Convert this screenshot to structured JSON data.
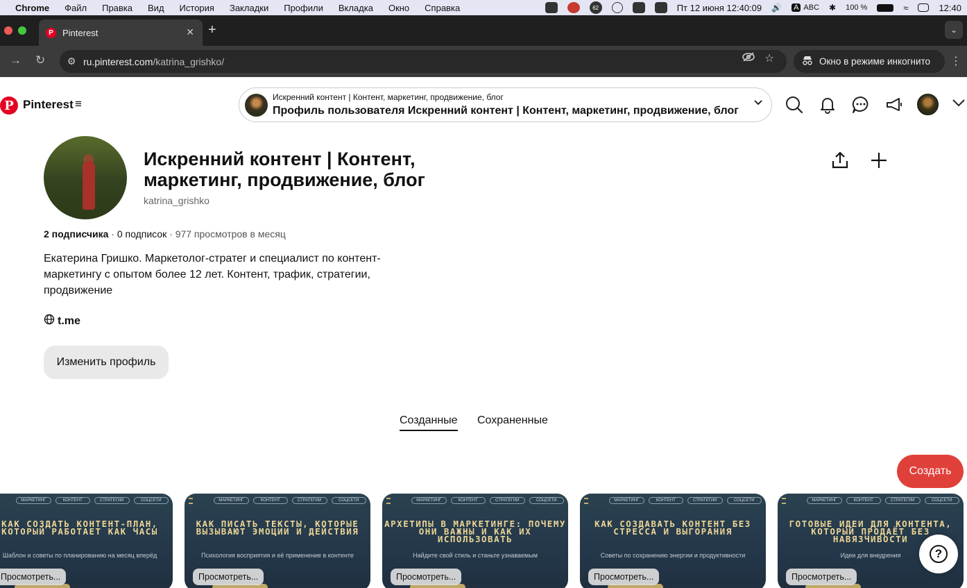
{
  "menubar": {
    "items": [
      "Chrome",
      "Файл",
      "Правка",
      "Вид",
      "История",
      "Закладки",
      "Профили",
      "Вкладка",
      "Окно",
      "Справка"
    ],
    "badge": "62",
    "kbd": "ABC",
    "battery": "100 %",
    "date": "Пт 12 июня  12:40:09",
    "clock": "12:40"
  },
  "browser": {
    "tab_title": "Pinterest",
    "url_host": "ru.pinterest.com",
    "url_path": "/katrina_grishko/",
    "incognito_label": "Окно в режиме инкогнито"
  },
  "header": {
    "brand": "Pinterest",
    "search_small": "Искренний контент | Контент, маркетинг, продвижение, блог",
    "search_big": "Профиль пользователя Искренний контент | Контент, маркетинг, продвижение, блог"
  },
  "profile": {
    "name": "Искренний контент | Контент, маркетинг, продвижение, блог",
    "username": "katrina_grishko",
    "followers": "2 подписчика",
    "following": "0 подписок",
    "views": "977 просмотров в месяц",
    "sep": "·",
    "about": "Екатерина Гришко. Маркетолог-стратег и специалист по контент-маркетингу с опытом более 12 лет. Контент, трафик, стратегии, продвижение",
    "link": "t.me",
    "edit_label": "Изменить профиль"
  },
  "tabs": {
    "created": "Созданные",
    "saved": "Сохраненные"
  },
  "create_label": "Создать",
  "help_label": "?",
  "pins": [
    {
      "title": "КАК СОЗДАТЬ КОНТЕНТ-ПЛАН, КОТОРЫЙ РАБОТАЕТ КАК ЧАСЫ",
      "subtitle": "Шаблон и советы по планированию на месяц вперёд",
      "view": "Просмотреть..."
    },
    {
      "title": "КАК ПИСАТЬ ТЕКСТЫ, КОТОРЫЕ ВЫЗЫВАЮТ ЭМОЦИИ И ДЕЙСТВИЯ",
      "subtitle": "Психология восприятия и её применение в контенте",
      "view": "Просмотреть..."
    },
    {
      "title": "АРХЕТИПЫ В МАРКЕТИНГЕ: ПОЧЕМУ ОНИ ВАЖНЫ И КАК ИХ ИСПОЛЬЗОВАТЬ",
      "subtitle": "Найдите свой стиль и станьте узнаваемым",
      "view": "Просмотреть..."
    },
    {
      "title": "КАК СОЗДАВАТЬ КОНТЕНТ БЕЗ СТРЕССА И ВЫГОРАНИЯ",
      "subtitle": "Советы по сохранению энергии и продуктивности",
      "view": "Просмотреть..."
    },
    {
      "title": "ГОТОВЫЕ ИДЕИ ДЛЯ КОНТЕНТА, КОТОРЫЙ ПРОДАЁТ БЕЗ НАВЯЗЧИВОСТИ",
      "subtitle": "Идеи для внедрения",
      "view": "Просмотреть..."
    }
  ],
  "pin_chips": [
    "МАРКЕТИНГ",
    "КОНТЕНТ",
    "СТРАТЕГИИ",
    "СОЦСЕТИ"
  ],
  "colors": {
    "pinterest_red": "#e60023",
    "create_button": "#e0403a",
    "pin_bg": "#24374a",
    "pin_title": "#ecd596"
  }
}
